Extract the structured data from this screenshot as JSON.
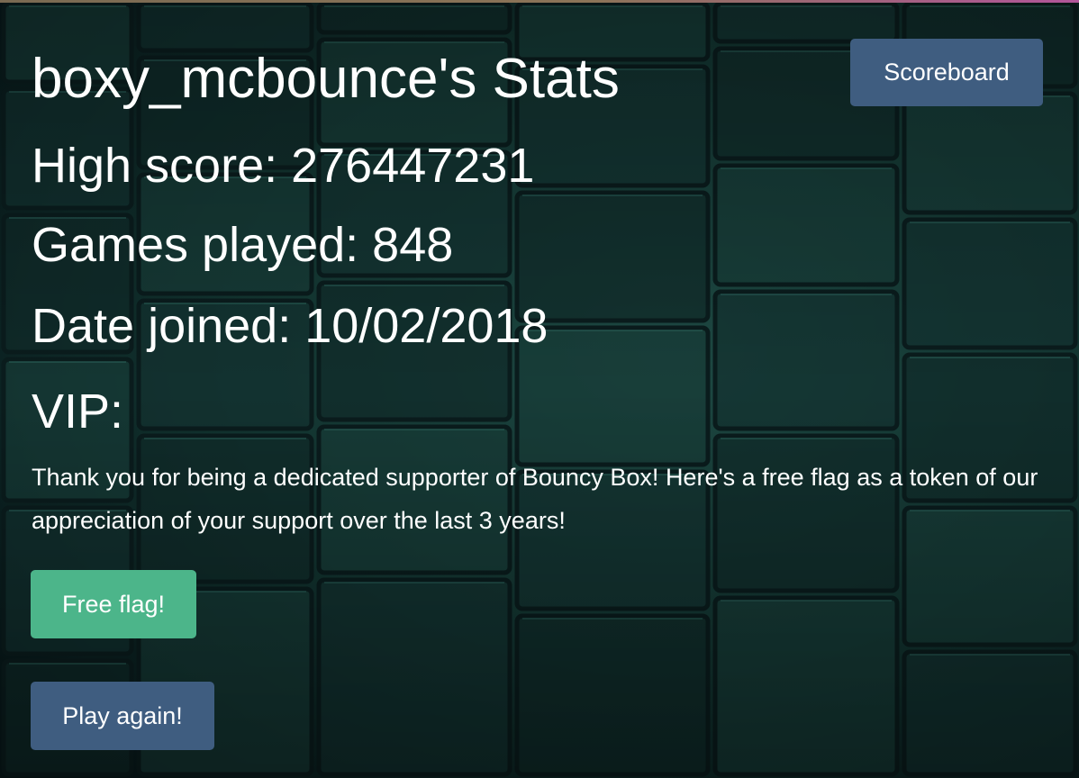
{
  "header": {
    "title": "boxy_mcbounce's Stats",
    "scoreboard_label": "Scoreboard"
  },
  "stats": {
    "high_score": "High score: 276447231",
    "games_played": "Games played: 848",
    "date_joined": "Date joined: 10/02/2018",
    "vip": "VIP:"
  },
  "message": "Thank you for being a dedicated supporter of Bouncy Box! Here's a free flag as a token of our appreciation of your support over the last 3 years!",
  "actions": {
    "free_flag_label": "Free flag!",
    "play_again_label": "Play again!"
  },
  "colors": {
    "background": "#0d2624",
    "primary_button": "#3f5d80",
    "success_button": "#4cb58a",
    "text": "#ffffff"
  },
  "icons": {
    "background": "tiled-3d-cubes-background"
  }
}
